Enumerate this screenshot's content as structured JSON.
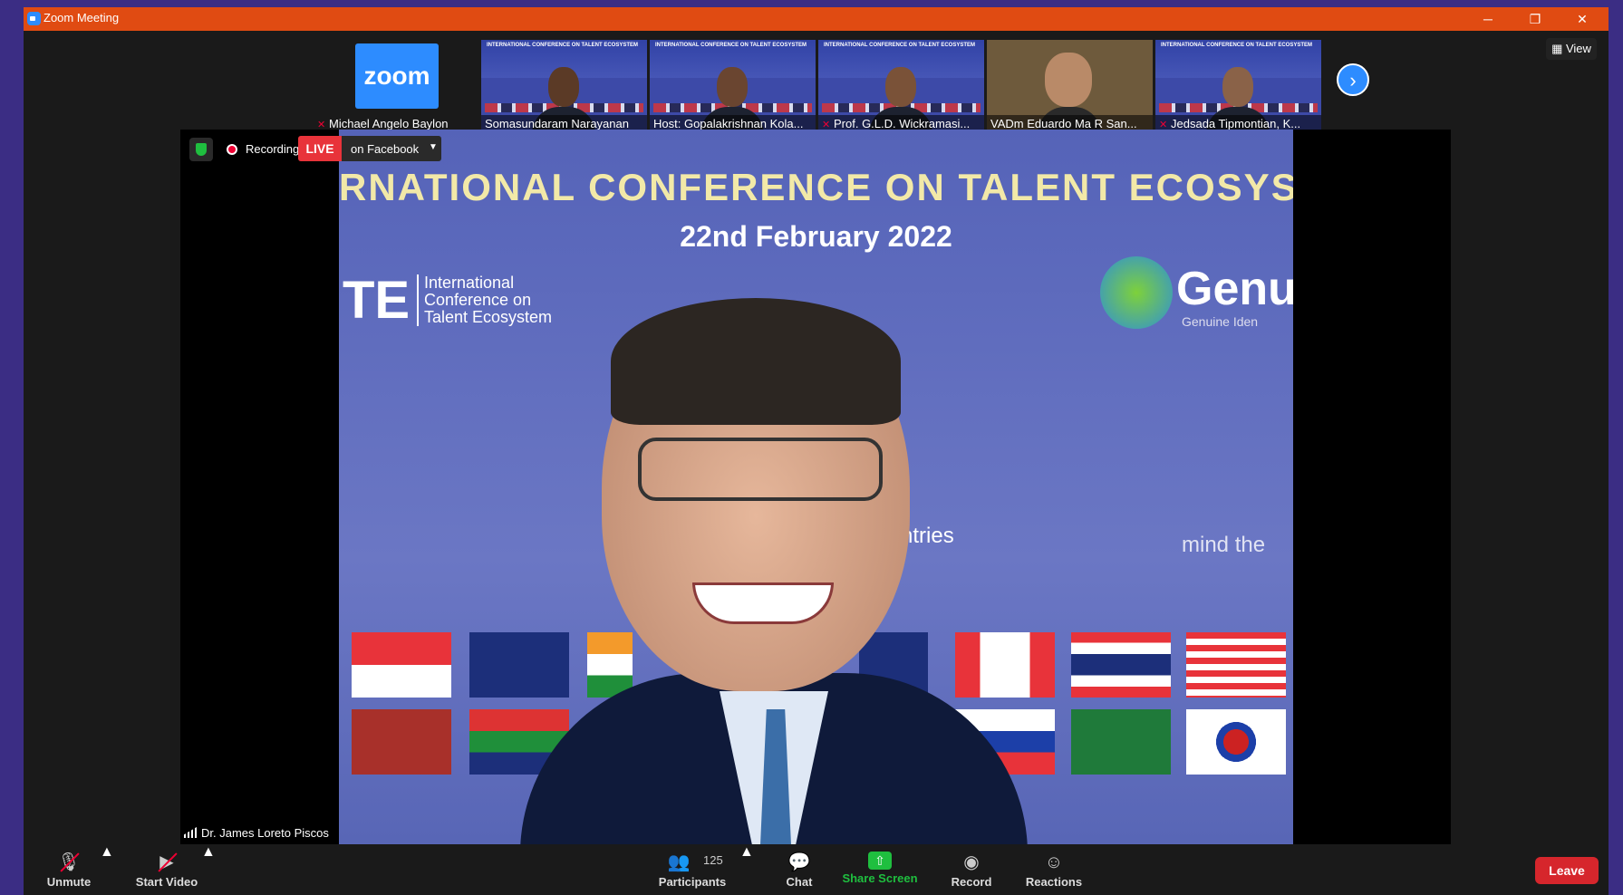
{
  "window": {
    "title": "Zoom Meeting",
    "minimize_label": "─",
    "restore_label": "❐",
    "close_label": "✕"
  },
  "top": {
    "view_label": "View",
    "next_label": "›"
  },
  "participants_strip": [
    {
      "name": "Michael Angelo Baylon",
      "muted": true,
      "logo": "zoom"
    },
    {
      "name": "Somasundaram Narayanan",
      "muted": false
    },
    {
      "name": "Host: Gopalakrishnan Kola...",
      "muted": false
    },
    {
      "name": "Prof. G.L.D. Wickramasi...",
      "muted": true
    },
    {
      "name": "VADm Eduardo Ma R  San...",
      "muted": false
    },
    {
      "name": "Jedsada Tipmontian, K...",
      "muted": true
    }
  ],
  "tile_banner_text": "INTERNATIONAL CONFERENCE ON TALENT ECOSYSTEM",
  "zoom_logo_text": "zoom",
  "stage": {
    "recording_label": "Recording",
    "live_badge": "LIVE",
    "live_platform": "on Facebook",
    "active_speaker": "Dr. James Loreto Piscos"
  },
  "slide": {
    "headline": "RNATIONAL CONFERENCE ON TALENT ECOSYS",
    "date": "22nd February 2022",
    "logo_letters": "TE",
    "logo_caption": "International Conference on Talent Ecosystem",
    "sponsor": "Genui",
    "sponsor_tagline": "Genuine Iden",
    "countries_fragment": "ntries",
    "mind_fragment": "mind the"
  },
  "toolbar": {
    "unmute_label": "Unmute",
    "start_video_label": "Start Video",
    "participants_label": "Participants",
    "participants_count": "125",
    "chat_label": "Chat",
    "share_label": "Share Screen",
    "record_label": "Record",
    "reactions_label": "Reactions",
    "leave_label": "Leave"
  }
}
